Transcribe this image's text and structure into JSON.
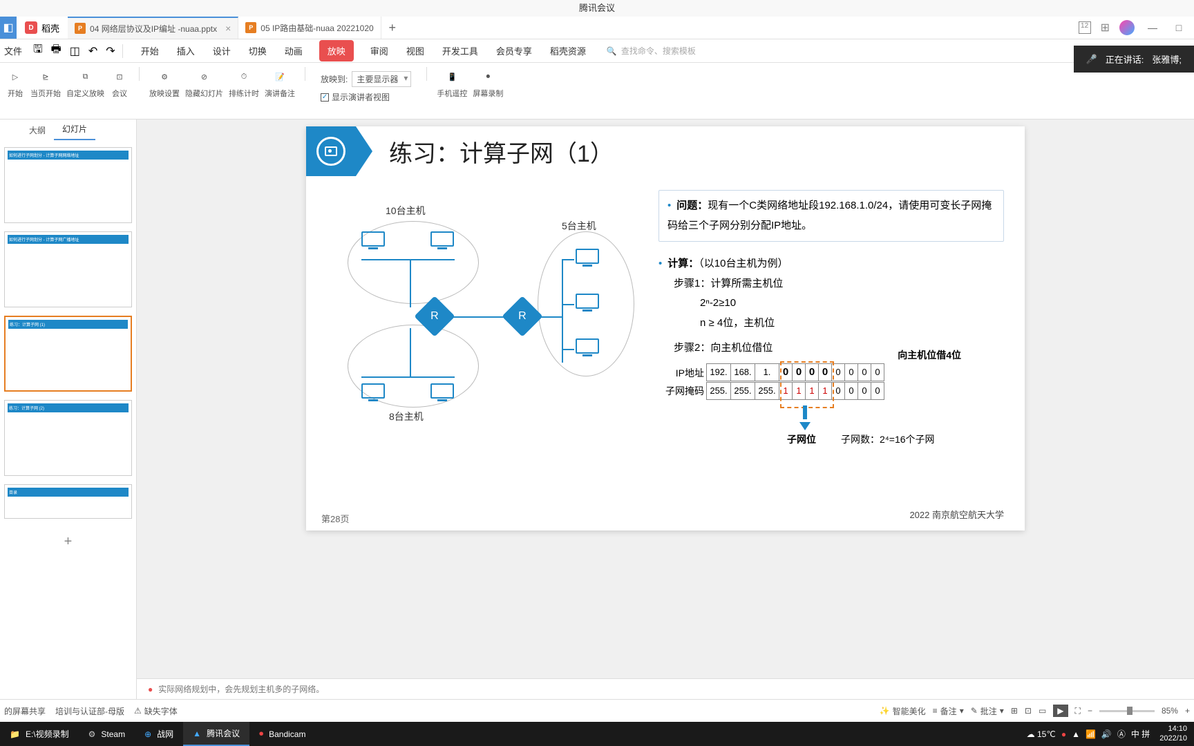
{
  "window_title": "腾讯会议",
  "tabs": {
    "dk_label": "稻壳",
    "file1": "04 网络层协议及IP编址 -nuaa.pptx",
    "file2": "05 IP路由基础-nuaa 20221020"
  },
  "menu": {
    "items": [
      "开始",
      "插入",
      "设计",
      "切换",
      "动画",
      "放映",
      "审阅",
      "视图",
      "开发工具",
      "会员专享",
      "稻壳资源"
    ],
    "search_placeholder": "查找命令、搜索模板"
  },
  "speaking": {
    "label": "正在讲话:",
    "name": "张雅博;"
  },
  "ribbon": {
    "btn1": "开始",
    "btn2": "当页开始",
    "btn3": "自定义放映",
    "btn4": "会议",
    "btn5": "放映设置",
    "btn6": "隐藏幻灯片",
    "btn7": "排练计时",
    "btn8": "演讲备注",
    "play_to": "放映到:",
    "display": "主要显示器",
    "checkbox": "显示演讲者视图",
    "btn9": "手机遥控",
    "btn10": "屏幕录制"
  },
  "side": {
    "tab1": "大纲",
    "tab2": "幻灯片"
  },
  "slide": {
    "title": "练习：计算子网（1）",
    "problem_label": "问题：",
    "problem_text": "现有一个C类网络地址段192.168.1.0/24，请使用可变长子网掩码给三个子网分别分配IP地址。",
    "calc_label": "计算：",
    "calc_example": "（以10台主机为例）",
    "step1": "步骤1：计算所需主机位",
    "formula1": "2ⁿ-2≥10",
    "formula2": "n ≥ 4位，主机位",
    "step2": "步骤2：向主机位借位",
    "borrow_label": "向主机位借4位",
    "ip_label": "IP地址",
    "mask_label": "子网掩码",
    "ip_octets": [
      "192.",
      "168.",
      "1."
    ],
    "mask_octets": [
      "255.",
      "255.",
      "255."
    ],
    "ip_bits": [
      "0",
      "0",
      "0",
      "0",
      "0",
      "0",
      "0",
      "0"
    ],
    "mask_bits": [
      "1",
      "1",
      "1",
      "1",
      "0",
      "0",
      "0",
      "0"
    ],
    "subnet_label": "子网位",
    "subnet_count": "子网数：2⁴=16个子网",
    "host10": "10台主机",
    "host8": "8台主机",
    "host5": "5台主机",
    "page": "第28页",
    "footer": "2022 南京航空航天大学"
  },
  "notes": "实际网络规划中，会先规划主机多的子网络。",
  "status": {
    "share": "的屏幕共享",
    "template": "培训与认证部-母版",
    "missing": "缺失字体",
    "beautify": "智能美化",
    "memo": "备注",
    "approve": "批注",
    "zoom": "85%"
  },
  "taskbar": {
    "items": [
      "E:\\视频录制",
      "Steam",
      "战网",
      "腾讯会议",
      "Bandicam"
    ],
    "temp": "15℃",
    "ime": "中 拼",
    "time": "14:10",
    "date": "2022/10"
  }
}
